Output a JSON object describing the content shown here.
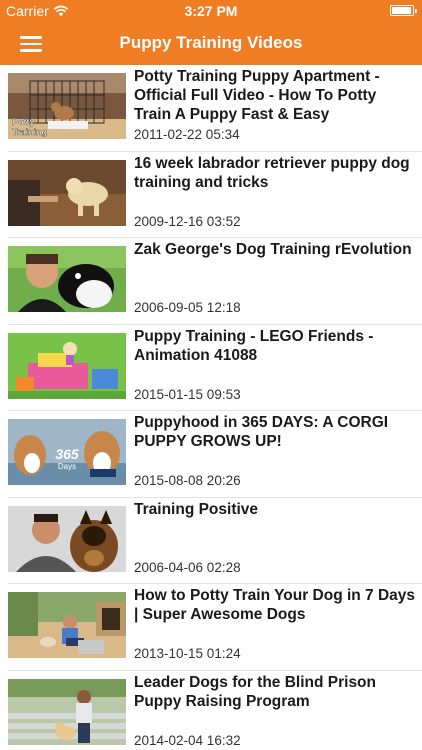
{
  "status_bar": {
    "carrier": "Carrier",
    "time": "3:27 PM",
    "battery_level": 0.95
  },
  "nav": {
    "title": "Puppy Training Videos",
    "menu_icon": "hamburger-menu-icon"
  },
  "colors": {
    "accent": "#ee7d24",
    "title_text": "#1a1a1a",
    "date_text": "#333333",
    "separator": "#e3e3e3"
  },
  "videos": [
    {
      "title": "Potty Training Puppy Apartment - Official Full Video - How To Potty Train A Puppy Fast & Easy",
      "date": "2011-02-22 05:34",
      "thumb_caption": [
        "Potty",
        "Training"
      ]
    },
    {
      "title": "16 week labrador retriever puppy dog training and tricks",
      "date": "2009-12-16 03:52"
    },
    {
      "title": "Zak George's Dog Training rEvolution",
      "date": "2006-09-05 12:18"
    },
    {
      "title": "Puppy Training  - LEGO Friends - Animation 41088",
      "date": "2015-01-15 09:53"
    },
    {
      "title": "Puppyhood in 365 DAYS: A CORGI PUPPY GROWS UP!",
      "date": "2015-08-08 20:26",
      "thumb_caption": [
        "365",
        "Days"
      ]
    },
    {
      "title": "Training Positive",
      "date": "2006-04-06 02:28"
    },
    {
      "title": "How to Potty Train Your Dog in 7 Days | Super Awesome Dogs",
      "date": "2013-10-15 01:24"
    },
    {
      "title": "Leader Dogs for the Blind Prison Puppy Raising Program",
      "date": "2014-02-04 16:32"
    }
  ]
}
